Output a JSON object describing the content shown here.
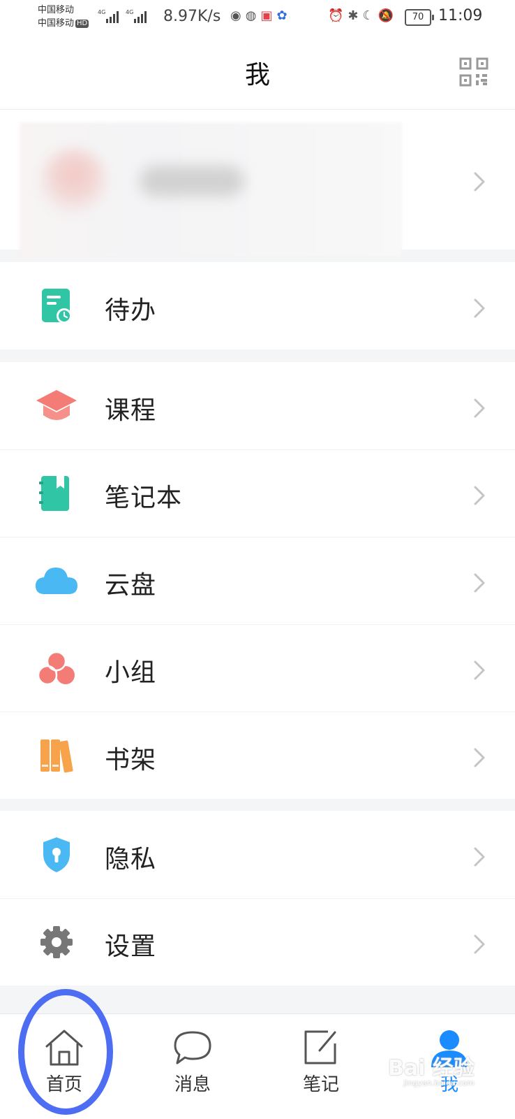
{
  "status_bar": {
    "carrier_1": "中国移动",
    "carrier_2": "中国移动",
    "hd": "HD",
    "net_1": "4G",
    "net_2": "4G",
    "speed": "8.97K/s",
    "battery": "70",
    "time": "11:09"
  },
  "header": {
    "title": "我"
  },
  "profile": {
    "username": ""
  },
  "sections": [
    {
      "items": [
        {
          "label": "待办",
          "icon": "todo-icon",
          "color": "#2fc5a5"
        }
      ]
    },
    {
      "items": [
        {
          "label": "课程",
          "icon": "course-icon",
          "color": "#f47c76"
        },
        {
          "label": "笔记本",
          "icon": "notebook-icon",
          "color": "#2fc5a5"
        },
        {
          "label": "云盘",
          "icon": "cloud-icon",
          "color": "#4ab8f3"
        },
        {
          "label": "小组",
          "icon": "group-icon",
          "color": "#f47c76"
        },
        {
          "label": "书架",
          "icon": "bookshelf-icon",
          "color": "#f6a34b"
        }
      ]
    },
    {
      "items": [
        {
          "label": "隐私",
          "icon": "privacy-icon",
          "color": "#4ab8f3"
        },
        {
          "label": "设置",
          "icon": "settings-icon",
          "color": "#777777"
        }
      ]
    }
  ],
  "tabs": [
    {
      "label": "首页",
      "icon": "home-icon"
    },
    {
      "label": "消息",
      "icon": "message-icon"
    },
    {
      "label": "笔记",
      "icon": "note-icon"
    },
    {
      "label": "我",
      "icon": "me-icon",
      "active": true
    }
  ],
  "accent_color": "#1a8cff",
  "watermark": {
    "brand": "Bai 经验",
    "url": "jingyan.baidu.com"
  }
}
